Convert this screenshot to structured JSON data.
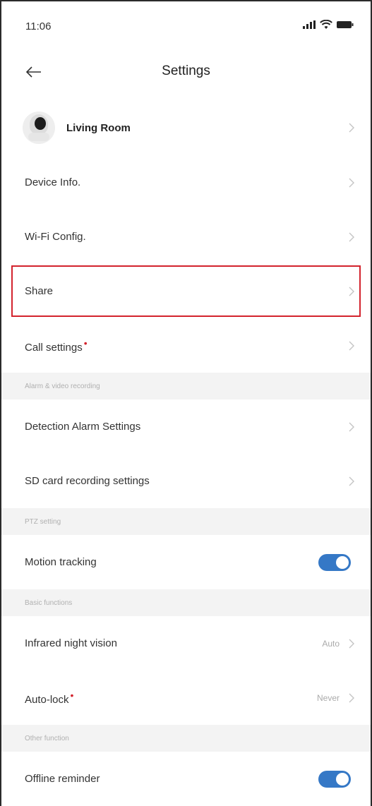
{
  "status_bar": {
    "time": "11:06"
  },
  "header": {
    "title": "Settings"
  },
  "device": {
    "name": "Living Room"
  },
  "items": {
    "device_info": "Device Info.",
    "wifi_config": "Wi-Fi Config.",
    "share": "Share",
    "call_settings": "Call settings"
  },
  "sections": {
    "alarm": "Alarm & video recording",
    "ptz": "PTZ setting",
    "basic": "Basic functions",
    "other": "Other function"
  },
  "alarm_items": {
    "detection": "Detection Alarm Settings",
    "sd_card": "SD card recording settings"
  },
  "ptz_items": {
    "motion_tracking": "Motion tracking",
    "motion_tracking_on": true
  },
  "basic_items": {
    "infrared": "Infrared night vision",
    "infrared_value": "Auto",
    "auto_lock": "Auto-lock",
    "auto_lock_value": "Never"
  },
  "other_items": {
    "offline_reminder": "Offline reminder",
    "offline_reminder_on": true
  },
  "badge_dot": "•",
  "colors": {
    "accent": "#3578c6",
    "highlight": "#d3232d",
    "badge": "#d3232d"
  }
}
